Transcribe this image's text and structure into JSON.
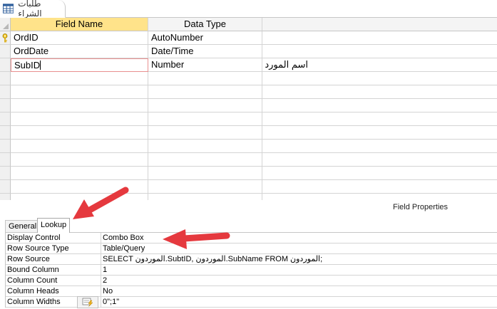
{
  "document_tab": {
    "label": "طلبات الشراء",
    "icon": "table-icon"
  },
  "grid": {
    "headers": {
      "field_name": "Field Name",
      "data_type": "Data Type",
      "description": ""
    },
    "rows": [
      {
        "field": "OrdID",
        "type": "AutoNumber",
        "description": "",
        "primary_key": true
      },
      {
        "field": "OrdDate",
        "type": "Date/Time",
        "description": ""
      },
      {
        "field": "SubID",
        "type": "Number",
        "description": "اسم المورد"
      }
    ]
  },
  "field_properties": {
    "title": "Field Properties",
    "tabs": {
      "general": "General",
      "lookup": "Lookup"
    },
    "rows": [
      {
        "label": "Display Control",
        "value": "Combo Box"
      },
      {
        "label": "Row Source Type",
        "value": "Table/Query"
      },
      {
        "label": "Row Source",
        "value": "SELECT الموردون.SubtID, الموردون.SubName FROM الموردون;"
      },
      {
        "label": "Bound Column",
        "value": "1"
      },
      {
        "label": "Column Count",
        "value": "2"
      },
      {
        "label": "Column Heads",
        "value": "No"
      },
      {
        "label": "Column Widths",
        "value": "0\";1\""
      }
    ]
  },
  "colors": {
    "header_active": "#ffe38a",
    "annotation_arrow": "#e5393e"
  }
}
